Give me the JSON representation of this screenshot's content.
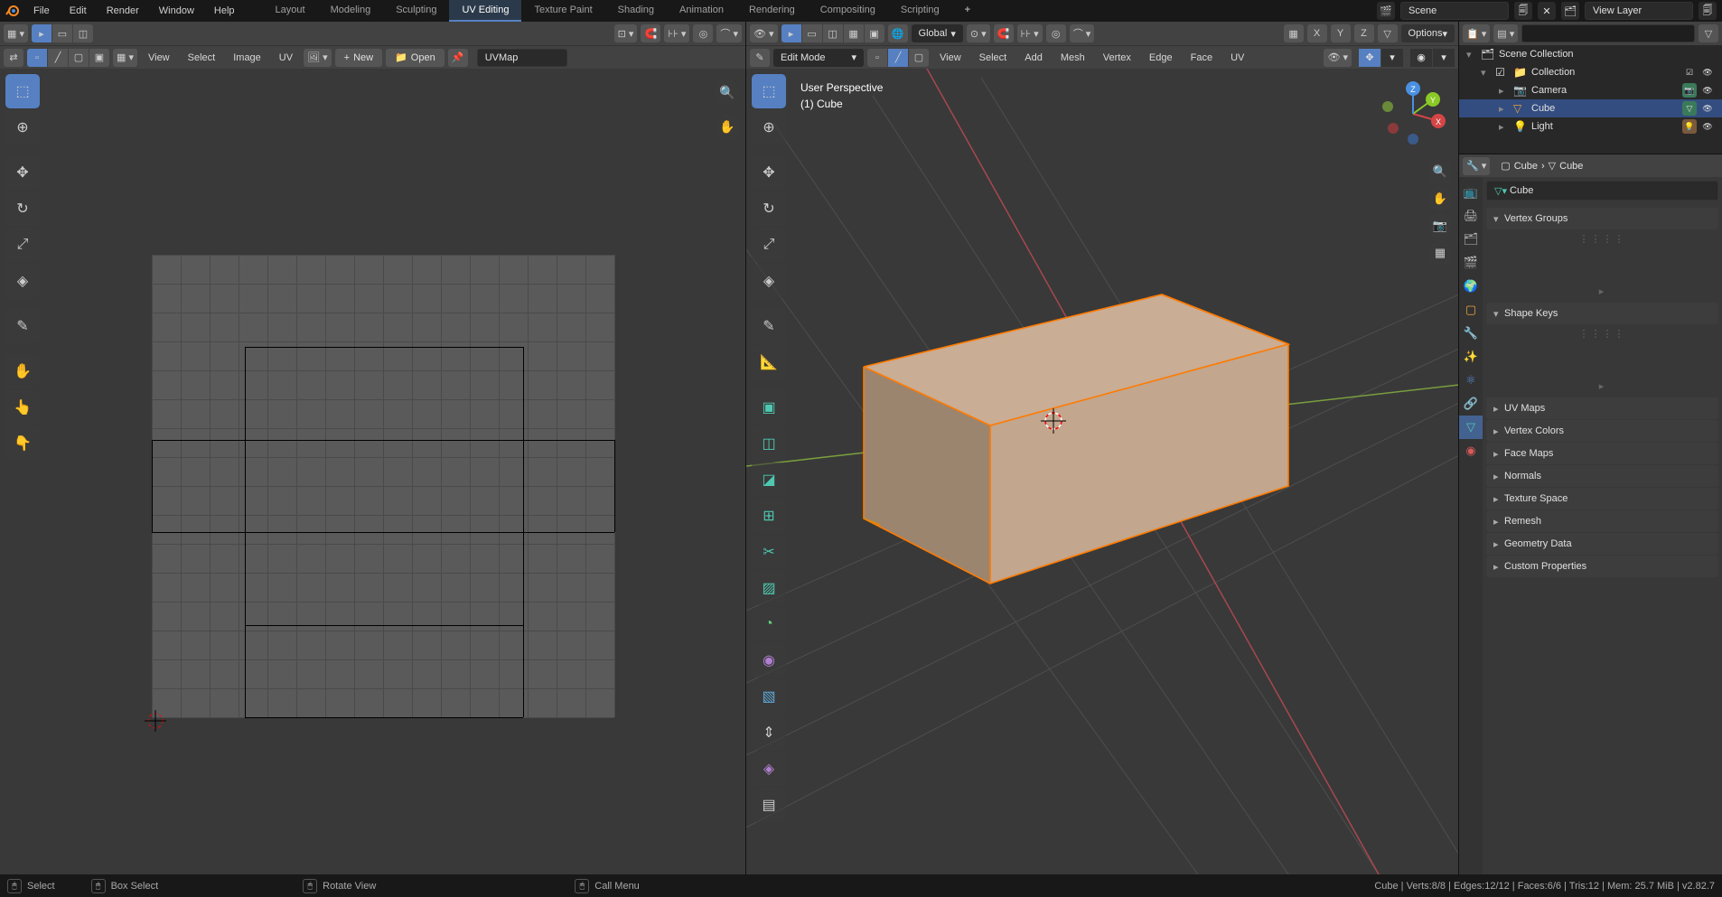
{
  "top_menu": [
    "File",
    "Edit",
    "Render",
    "Window",
    "Help"
  ],
  "workspaces": [
    "Layout",
    "Modeling",
    "Sculpting",
    "UV Editing",
    "Texture Paint",
    "Shading",
    "Animation",
    "Rendering",
    "Compositing",
    "Scripting"
  ],
  "active_workspace": "UV Editing",
  "scene_name": "Scene",
  "view_layer": "View Layer",
  "uv": {
    "menus": [
      "View",
      "Select",
      "Image",
      "UV"
    ],
    "btn_new": "New",
    "btn_open": "Open",
    "uvmap": "UVMap"
  },
  "v3d": {
    "mode": "Edit Mode",
    "menus": [
      "View",
      "Select",
      "Add",
      "Mesh",
      "Vertex",
      "Edge",
      "Face",
      "UV"
    ],
    "orient": "Global",
    "options": "Options",
    "persp_line1": "User Perspective",
    "persp_line2": "(1) Cube",
    "xyz": [
      "X",
      "Y",
      "Z"
    ]
  },
  "outliner": {
    "scene_collection": "Scene Collection",
    "collection": "Collection",
    "camera": "Camera",
    "cube": "Cube",
    "light": "Light"
  },
  "props": {
    "obj_label": "Cube",
    "cube_label": "Cube",
    "data_name": "Cube",
    "panels": [
      "Vertex Groups",
      "Shape Keys",
      "UV Maps",
      "Vertex Colors",
      "Face Maps",
      "Normals",
      "Texture Space",
      "Remesh",
      "Geometry Data",
      "Custom Properties"
    ]
  },
  "status": {
    "select": "Select",
    "box_select": "Box Select",
    "rotate_view": "Rotate View",
    "call_menu": "Call Menu",
    "right": "Cube | Verts:8/8 | Edges:12/12 | Faces:6/6 | Tris:12 | Mem: 25.7 MiB | v2.82.7"
  }
}
